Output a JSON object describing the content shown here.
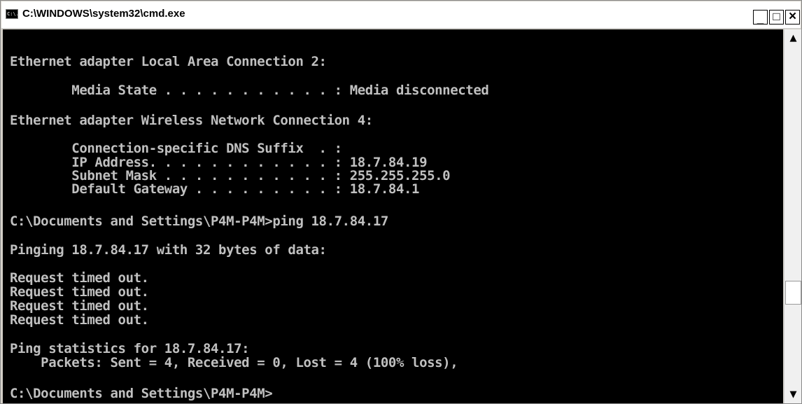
{
  "window": {
    "title": "C:\\WINDOWS\\system32\\cmd.exe",
    "icon_text": "C:\\.",
    "minimize_label": "_",
    "maximize_label": "□",
    "close_label": "×"
  },
  "console": {
    "lines": [
      "Ethernet adapter Local Area Connection 2:",
      "        Media State . . . . . . . . . . . : Media disconnected",
      "Ethernet adapter Wireless Network Connection 4:",
      "        Connection-specific DNS Suffix  . :",
      "        IP Address. . . . . . . . . . . . : 18.7.84.19",
      "        Subnet Mask . . . . . . . . . . . : 255.255.255.0",
      "        Default Gateway . . . . . . . . . : 18.7.84.1",
      "C:\\Documents and Settings\\P4M-P4M>ping 18.7.84.17",
      "Pinging 18.7.84.17 with 32 bytes of data:",
      "Request timed out.",
      "Request timed out.",
      "Request timed out.",
      "Request timed out.",
      "Ping statistics for 18.7.84.17:",
      "    Packets: Sent = 4, Received = 0, Lost = 4 (100% loss),",
      "C:\\Documents and Settings\\P4M-P4M>"
    ]
  },
  "scrollbar": {
    "up_arrow": "▲",
    "down_arrow": "▼"
  }
}
